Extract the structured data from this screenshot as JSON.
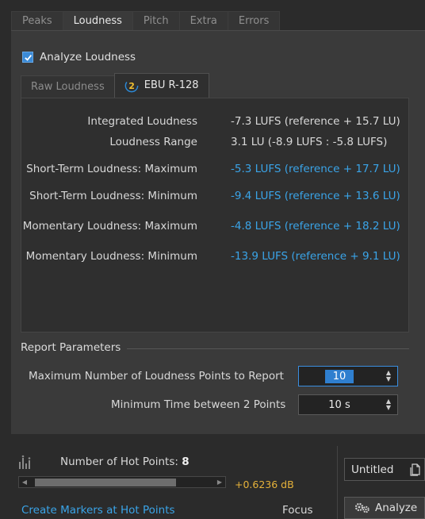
{
  "top_tabs": [
    "Peaks",
    "Loudness",
    "Pitch",
    "Extra",
    "Errors"
  ],
  "analyze_checkbox": {
    "label": "Analyze Loudness",
    "checked": true
  },
  "sub_tabs": [
    "Raw Loudness",
    "EBU R-128"
  ],
  "results": [
    {
      "label": "Integrated Loudness",
      "value": "-7.3 LUFS (reference + 15.7 LU)",
      "color": "white"
    },
    {
      "label": "Loudness Range",
      "value": "3.1 LU (-8.9 LUFS : -5.8 LUFS)",
      "color": "white"
    },
    {
      "label": "Short-Term Loudness: Maximum",
      "value": "-5.3 LUFS (reference + 17.7 LU)",
      "color": "blue"
    },
    {
      "label": "Short-Term Loudness: Minimum",
      "value": "-9.4 LUFS (reference + 13.6 LU)",
      "color": "blue"
    },
    {
      "label": "Momentary Loudness: Maximum",
      "value": "-4.8 LUFS (reference + 18.2 LU)",
      "color": "blue"
    },
    {
      "label": "Momentary Loudness: Minimum",
      "value": "-13.9 LUFS (reference + 9.1 LU)",
      "color": "blue"
    }
  ],
  "report_parameters": {
    "title": "Report Parameters",
    "max_points_label": "Maximum Number of Loudness Points to Report",
    "max_points_value": "10",
    "min_time_label": "Minimum Time between 2 Points",
    "min_time_value": "10 s"
  },
  "hot_points": {
    "label": "Number of Hot Points:",
    "count": "8",
    "gain": "+0.6236 dB",
    "create_markers": "Create Markers at Hot Points",
    "focus": "Focus"
  },
  "file_selector": {
    "value": "Untitled"
  },
  "analyze_button": {
    "label": "Analyze"
  },
  "colors": {
    "accent_blue": "#3aa4e8",
    "gain_yellow": "#e6b23a",
    "checkbox_blue": "#3b8ad6"
  }
}
